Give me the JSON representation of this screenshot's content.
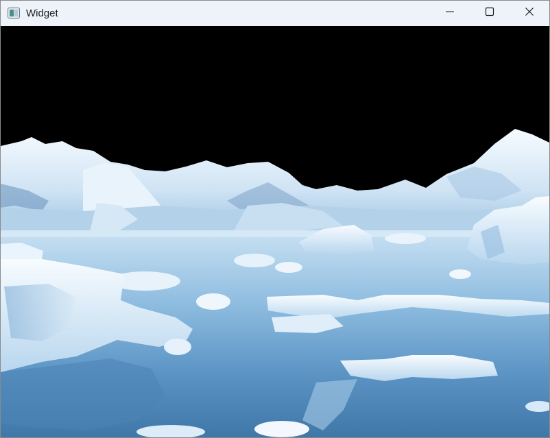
{
  "window": {
    "title": "Widget",
    "icons": {
      "app": "app-window-icon",
      "minimize": "minimize-icon",
      "maximize": "maximize-icon",
      "close": "close-icon"
    }
  },
  "content": {
    "image_subject": "icebergs-and-snowy-mountains-landscape",
    "colors": {
      "background": "#000000",
      "sky_band": "#000000",
      "water_deep": "#3f77a8",
      "water_light": "#a9cde8",
      "ice": "#eaf4fc"
    }
  }
}
